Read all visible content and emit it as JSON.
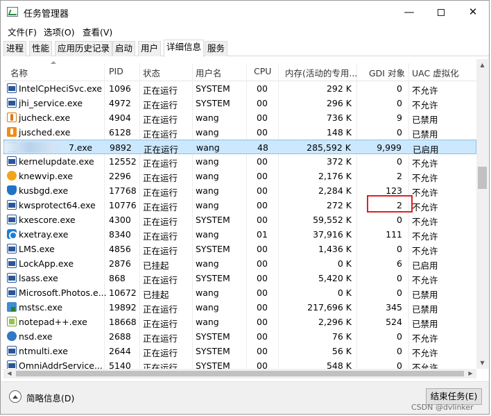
{
  "window": {
    "title": "任务管理器",
    "controls": {
      "minimize": "—",
      "maximize": "",
      "close": "✕"
    }
  },
  "menu": [
    "文件(F)",
    "选项(O)",
    "查看(V)"
  ],
  "tabs": [
    "进程",
    "性能",
    "应用历史记录",
    "启动",
    "用户",
    "详细信息",
    "服务"
  ],
  "active_tab": "详细信息",
  "columns": [
    "名称",
    "PID",
    "状态",
    "用户名",
    "CPU",
    "内存(活动的专用...",
    "GDI 对象",
    "UAC 虚拟化"
  ],
  "rows": [
    {
      "icon": "service-icon",
      "name": "IntelCpHeciSvc.exe",
      "pid": "1096",
      "status": "正在运行",
      "user": "SYSTEM",
      "cpu": "00",
      "mem": "292 K",
      "gdi": "0",
      "uac": "不允许"
    },
    {
      "icon": "service-icon",
      "name": "jhi_service.exe",
      "pid": "4972",
      "status": "正在运行",
      "user": "SYSTEM",
      "cpu": "00",
      "mem": "296 K",
      "gdi": "0",
      "uac": "不允许"
    },
    {
      "icon": "java-icon",
      "name": "jucheck.exe",
      "pid": "4904",
      "status": "正在运行",
      "user": "wang",
      "cpu": "00",
      "mem": "736 K",
      "gdi": "9",
      "uac": "已禁用"
    },
    {
      "icon": "java-update-icon",
      "name": "jusched.exe",
      "pid": "6128",
      "status": "正在运行",
      "user": "wang",
      "cpu": "00",
      "mem": "148 K",
      "gdi": "0",
      "uac": "已禁用"
    },
    {
      "icon": "blurred-app-icon",
      "name": "7.exe",
      "pid": "9892",
      "status": "正在运行",
      "user": "wang",
      "cpu": "48",
      "mem": "285,592 K",
      "gdi": "9,999",
      "uac": "已启用",
      "selected": true
    },
    {
      "icon": "service-icon",
      "name": "kernelupdate.exe",
      "pid": "12552",
      "status": "正在运行",
      "user": "wang",
      "cpu": "00",
      "mem": "372 K",
      "gdi": "0",
      "uac": "不允许"
    },
    {
      "icon": "knewvip-icon",
      "name": "knewvip.exe",
      "pid": "2296",
      "status": "正在运行",
      "user": "wang",
      "cpu": "00",
      "mem": "2,176 K",
      "gdi": "2",
      "uac": "不允许"
    },
    {
      "icon": "shield-icon",
      "name": "kusbgd.exe",
      "pid": "17768",
      "status": "正在运行",
      "user": "wang",
      "cpu": "00",
      "mem": "2,284 K",
      "gdi": "123",
      "uac": "不允许"
    },
    {
      "icon": "service-icon",
      "name": "kwsprotect64.exe",
      "pid": "10776",
      "status": "正在运行",
      "user": "wang",
      "cpu": "00",
      "mem": "272 K",
      "gdi": "2",
      "uac": "不允许"
    },
    {
      "icon": "service-icon",
      "name": "kxescore.exe",
      "pid": "4300",
      "status": "正在运行",
      "user": "SYSTEM",
      "cpu": "00",
      "mem": "59,552 K",
      "gdi": "0",
      "uac": "不允许"
    },
    {
      "icon": "kxetray-icon",
      "name": "kxetray.exe",
      "pid": "8340",
      "status": "正在运行",
      "user": "wang",
      "cpu": "01",
      "mem": "37,916 K",
      "gdi": "111",
      "uac": "不允许"
    },
    {
      "icon": "service-icon",
      "name": "LMS.exe",
      "pid": "4856",
      "status": "正在运行",
      "user": "SYSTEM",
      "cpu": "00",
      "mem": "1,436 K",
      "gdi": "0",
      "uac": "不允许"
    },
    {
      "icon": "service-icon",
      "name": "LockApp.exe",
      "pid": "2876",
      "status": "已挂起",
      "user": "wang",
      "cpu": "00",
      "mem": "0 K",
      "gdi": "6",
      "uac": "已启用"
    },
    {
      "icon": "service-icon",
      "name": "lsass.exe",
      "pid": "868",
      "status": "正在运行",
      "user": "SYSTEM",
      "cpu": "00",
      "mem": "5,420 K",
      "gdi": "0",
      "uac": "不允许"
    },
    {
      "icon": "service-icon",
      "name": "Microsoft.Photos.e...",
      "pid": "10672",
      "status": "已挂起",
      "user": "wang",
      "cpu": "00",
      "mem": "0 K",
      "gdi": "0",
      "uac": "已禁用"
    },
    {
      "icon": "mstsc-icon",
      "name": "mstsc.exe",
      "pid": "19892",
      "status": "正在运行",
      "user": "wang",
      "cpu": "00",
      "mem": "217,696 K",
      "gdi": "345",
      "uac": "已禁用"
    },
    {
      "icon": "notepad-icon",
      "name": "notepad++.exe",
      "pid": "18668",
      "status": "正在运行",
      "user": "wang",
      "cpu": "00",
      "mem": "2,296 K",
      "gdi": "524",
      "uac": "已禁用"
    },
    {
      "icon": "nsd-icon",
      "name": "nsd.exe",
      "pid": "2688",
      "status": "正在运行",
      "user": "SYSTEM",
      "cpu": "00",
      "mem": "76 K",
      "gdi": "0",
      "uac": "不允许"
    },
    {
      "icon": "service-icon",
      "name": "ntmulti.exe",
      "pid": "2644",
      "status": "正在运行",
      "user": "SYSTEM",
      "cpu": "00",
      "mem": "56 K",
      "gdi": "0",
      "uac": "不允许"
    },
    {
      "icon": "service-icon",
      "name": "OmniAddrService...",
      "pid": "5140",
      "status": "正在运行",
      "user": "SYSTEM",
      "cpu": "00",
      "mem": "548 K",
      "gdi": "0",
      "uac": "不允许"
    }
  ],
  "footer": {
    "fewer_details": "简略信息(D)",
    "end_task": "结束任务(E)",
    "watermark": "CSDN @dvlinker"
  },
  "colors": {
    "selection": "#cce8ff",
    "highlight_border": "#e02020"
  }
}
